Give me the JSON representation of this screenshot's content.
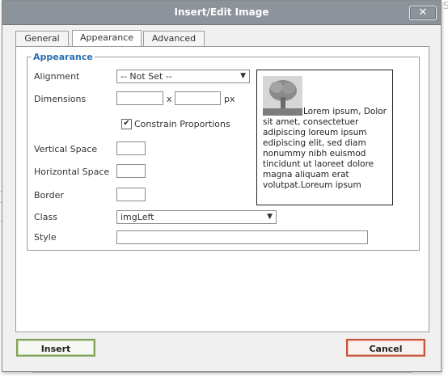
{
  "dialog": {
    "title": "Insert/Edit Image",
    "close_glyph": "✕"
  },
  "tabs": [
    {
      "label": "General",
      "active": false
    },
    {
      "label": "Appearance",
      "active": true
    },
    {
      "label": "Advanced",
      "active": false
    }
  ],
  "appearance": {
    "legend": "Appearance",
    "alignment": {
      "label": "Alignment",
      "value": "-- Not Set --"
    },
    "dimensions": {
      "label": "Dimensions",
      "separator": "x",
      "unit": "px",
      "width": "",
      "height": ""
    },
    "constrain": {
      "label": "Constrain Proportions",
      "checked": true
    },
    "vertical_space": {
      "label": "Vertical Space",
      "value": ""
    },
    "horizontal_space": {
      "label": "Horizontal Space",
      "value": ""
    },
    "border": {
      "label": "Border",
      "value": ""
    },
    "class": {
      "label": "Class",
      "value": "imgLeft"
    },
    "style": {
      "label": "Style",
      "value": ""
    },
    "preview_text": "Lorem ipsum, Dolor sit amet, consectetuer adipiscing loreum ipsum edipiscing elit, sed diam nonummy nibh euismod tincidunt ut laoreet dolore magna aliquam erat volutpat.Loreum ipsum"
  },
  "buttons": {
    "insert": "Insert",
    "cancel": "Cancel"
  },
  "icons": {
    "close": "close-icon",
    "dropdown": "chevron-down-icon",
    "check": "checkmark-icon",
    "preview": "tree-image-icon"
  }
}
